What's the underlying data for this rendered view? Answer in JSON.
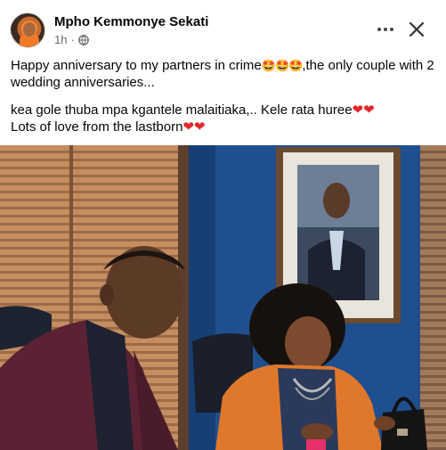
{
  "post": {
    "author": "Mpho Kemmonye Sekati",
    "time": "1h",
    "privacy_icon": "globe-icon",
    "more_icon": "more-options-icon",
    "close_icon": "close-icon",
    "line1_text": "Happy  anniversary to my partners in crime",
    "line1_emoji": "🤩🤩🤩",
    "line1_rest": ",the only couple with 2 wedding anniversaries...",
    "line2_text": "kea gole thuba mpa kgantele malaitiaka,.. Kele rata huree",
    "line2_emoji": "❤❤",
    "line3_text": "Lots of love from the lastborn",
    "line3_emoji": "❤❤"
  },
  "colors": {
    "heart": "#e0282e",
    "meta_gray": "#65676b",
    "wall_blue": "#1f4f8f",
    "blinds": "#b98257"
  }
}
